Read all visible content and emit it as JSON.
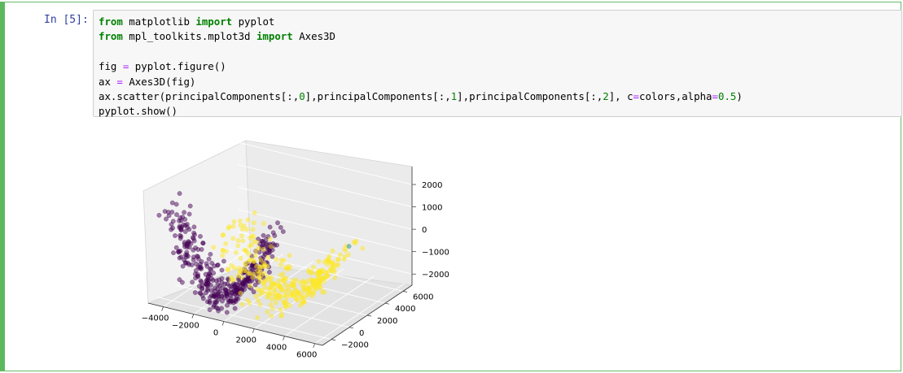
{
  "cell": {
    "prompt": "In [5]:",
    "code": {
      "line1": {
        "kw1": "from",
        "mod": " matplotlib ",
        "kw2": "import",
        "name": " pyplot"
      },
      "line2": {
        "kw1": "from",
        "mod": " mpl_toolkits.mplot3d ",
        "kw2": "import",
        "name": " Axes3D"
      },
      "line3": {
        "lhs": "fig ",
        "op": "=",
        "rhs": " pyplot.figure()"
      },
      "line4": {
        "lhs": "ax ",
        "op": "=",
        "rhs": " Axes3D(fig)"
      },
      "line5": {
        "a": "ax.scatter(principalComponents[:,",
        "n1": "0",
        "b": "],principalComponents[:,",
        "n2": "1",
        "c": "],principalComponents[:,",
        "n3": "2",
        "d": "], c",
        "op1": "=",
        "e": "colors,alpha",
        "op2": "=",
        "n4": "0.5",
        "f": ")"
      },
      "line6": "pyplot.show()"
    }
  },
  "chart_data": {
    "type": "scatter",
    "projection": "3d",
    "title": "",
    "xlabel": "",
    "ylabel": "",
    "zlabel": "",
    "x_ticks": [
      "−4000",
      "−2000",
      "0",
      "2000",
      "4000",
      "6000"
    ],
    "y_ticks": [
      "−2000",
      "0",
      "2000",
      "4000",
      "6000"
    ],
    "z_ticks": [
      "2000",
      "1000",
      "0",
      "−1000",
      "−2000"
    ],
    "colors": {
      "class_a": "#440154",
      "class_b": "#fde725",
      "class_c": "#21918c"
    },
    "alpha": 0.5,
    "series": [
      {
        "color_key": "class_a",
        "x_range": [
          -4500,
          2000
        ],
        "y_range": [
          -2500,
          500
        ],
        "z_range": [
          -2000,
          1500
        ],
        "n_points": 380
      },
      {
        "color_key": "class_b",
        "x_range": [
          -1500,
          5500
        ],
        "y_range": [
          -2000,
          3000
        ],
        "z_range": [
          -1800,
          800
        ],
        "n_points": 330
      },
      {
        "color_key": "class_c",
        "x_range": [
          5000,
          5000
        ],
        "y_range": [
          2500,
          2500
        ],
        "z_range": [
          200,
          200
        ],
        "n_points": 1
      }
    ]
  }
}
